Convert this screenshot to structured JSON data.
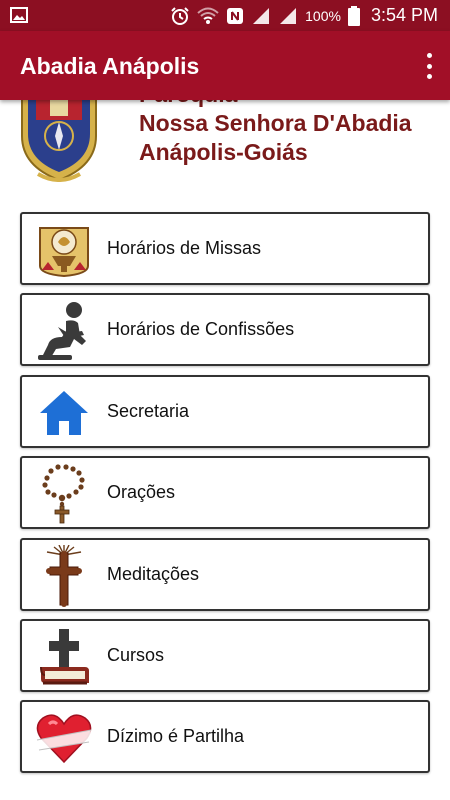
{
  "status_bar": {
    "battery": "100%",
    "time": "3:54 PM"
  },
  "app_bar": {
    "title": "Abadia Anápolis"
  },
  "header": {
    "line1": "Paróquia",
    "line2": "Nossa Senhora D'Abadia",
    "line3": "Anápolis-Goiás"
  },
  "menu": [
    {
      "label": "Horários de Missas",
      "icon": "chalice-icon"
    },
    {
      "label": "Horários de Confissões",
      "icon": "kneeling-person-icon"
    },
    {
      "label": "Secretaria",
      "icon": "home-icon"
    },
    {
      "label": "Orações",
      "icon": "rosary-icon"
    },
    {
      "label": "Meditações",
      "icon": "cross-radiant-icon"
    },
    {
      "label": "Cursos",
      "icon": "bible-cross-icon"
    },
    {
      "label": "Dízimo é Partilha",
      "icon": "heart-icon"
    }
  ],
  "colors": {
    "status_bar": "#8c0f22",
    "app_bar": "#a10f27",
    "header_text": "#7a1a1a",
    "home_icon": "#1e6fd6"
  }
}
